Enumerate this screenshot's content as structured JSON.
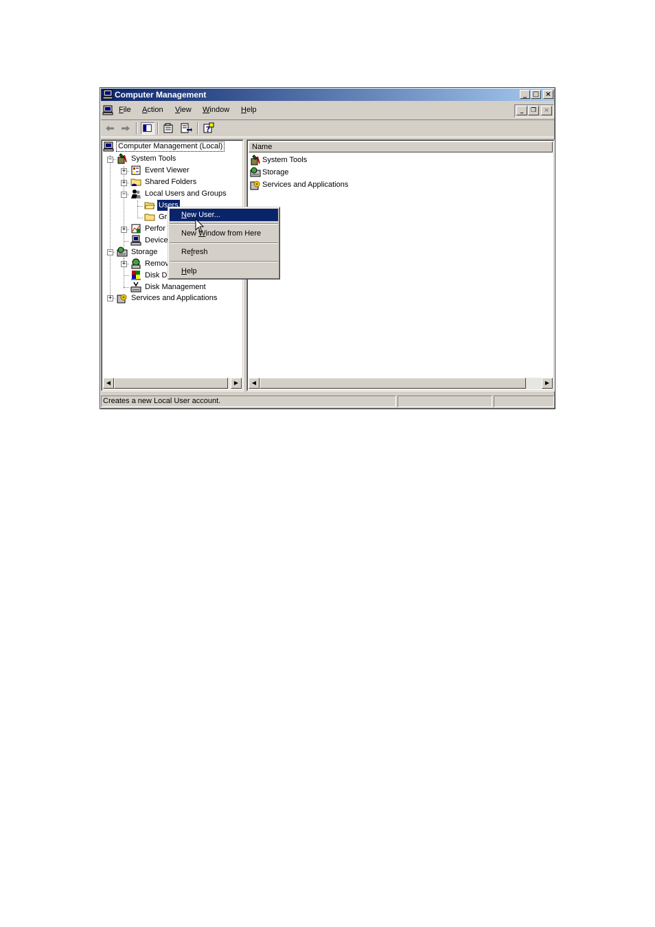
{
  "window": {
    "title": "Computer Management"
  },
  "menu": {
    "items": [
      {
        "pre": "",
        "key": "F",
        "post": "ile"
      },
      {
        "pre": "",
        "key": "A",
        "post": "ction"
      },
      {
        "pre": "",
        "key": "V",
        "post": "iew"
      },
      {
        "pre": "",
        "key": "W",
        "post": "indow"
      },
      {
        "pre": "",
        "key": "H",
        "post": "elp"
      }
    ]
  },
  "tree": {
    "root": "Computer Management (Local)",
    "system_tools": "System Tools",
    "event_viewer": "Event Viewer",
    "shared_folders": "Shared Folders",
    "local_users": "Local Users and Groups",
    "users": "Users",
    "groups_partial": "Gr",
    "performance_partial": "Perfor",
    "device_partial": "Device",
    "storage": "Storage",
    "removable_partial": "Remov",
    "disk_defrag_partial": "Disk D",
    "disk_management": "Disk Management",
    "services": "Services and Applications"
  },
  "list": {
    "column_name": "Name",
    "items": [
      "System Tools",
      "Storage",
      "Services and Applications"
    ]
  },
  "context_menu": {
    "new_user": {
      "pre": "",
      "key": "N",
      "post": "ew User..."
    },
    "new_window": {
      "pre": "New ",
      "key": "W",
      "post": "indow from Here"
    },
    "refresh": {
      "pre": "Re",
      "key": "f",
      "post": "resh"
    },
    "help": {
      "pre": "",
      "key": "H",
      "post": "elp"
    }
  },
  "status": {
    "text": "Creates a new Local User account."
  },
  "colors": {
    "title_start": "#0a246a",
    "title_end": "#a6caf0",
    "highlight": "#0a246a",
    "face": "#d4d0c8"
  }
}
